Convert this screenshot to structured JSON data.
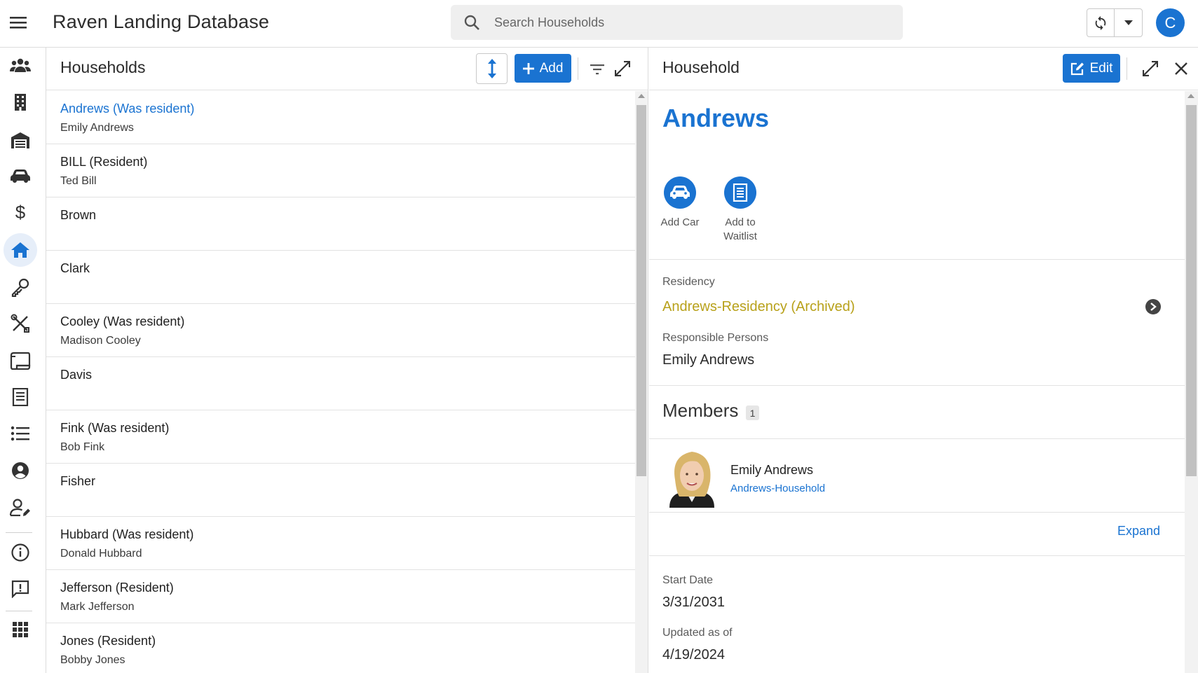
{
  "app": {
    "title": "Raven Landing Database",
    "user_initial": "C"
  },
  "search": {
    "placeholder": "Search Households"
  },
  "colors": {
    "accent": "#1a73d1",
    "archived_link": "#b8a11a"
  },
  "nav": [
    {
      "name": "people-icon",
      "active": false
    },
    {
      "name": "building-icon",
      "active": false
    },
    {
      "name": "garage-icon",
      "active": false
    },
    {
      "name": "car-icon",
      "active": false
    },
    {
      "name": "dollar-icon",
      "active": false
    },
    {
      "name": "home-icon",
      "active": true
    },
    {
      "name": "key-icon",
      "active": false
    },
    {
      "name": "tools-icon",
      "active": false
    },
    {
      "name": "scroll-icon",
      "active": false
    },
    {
      "name": "checklist-icon",
      "active": false
    },
    {
      "name": "list-icon",
      "active": false
    },
    {
      "name": "account-circle-icon",
      "active": false
    },
    {
      "name": "user-edit-icon",
      "active": false
    },
    {
      "name": "info-icon",
      "active": false
    },
    {
      "name": "feedback-icon",
      "active": false
    },
    {
      "name": "apps-grid-icon",
      "active": false
    }
  ],
  "list": {
    "title": "Households",
    "add_label": "Add",
    "items": [
      {
        "title": "Andrews (Was resident)",
        "subtitle": "Emily Andrews",
        "selected": true
      },
      {
        "title": "BILL (Resident)",
        "subtitle": "Ted Bill"
      },
      {
        "title": "Brown",
        "subtitle": ""
      },
      {
        "title": "Clark",
        "subtitle": ""
      },
      {
        "title": "Cooley (Was resident)",
        "subtitle": "Madison Cooley"
      },
      {
        "title": "Davis",
        "subtitle": ""
      },
      {
        "title": "Fink (Was resident)",
        "subtitle": "Bob Fink"
      },
      {
        "title": "Fisher",
        "subtitle": ""
      },
      {
        "title": "Hubbard (Was resident)",
        "subtitle": "Donald Hubbard"
      },
      {
        "title": "Jefferson (Resident)",
        "subtitle": "Mark Jefferson"
      },
      {
        "title": "Jones (Resident)",
        "subtitle": "Bobby Jones"
      }
    ]
  },
  "detail": {
    "title": "Household",
    "edit_label": "Edit",
    "name": "Andrews",
    "actions": [
      {
        "label": "Add Car",
        "icon": "car-icon"
      },
      {
        "label": "Add to Waitlist",
        "icon": "list-form-icon"
      }
    ],
    "residency_label": "Residency",
    "residency_value": "Andrews-Residency (Archived)",
    "responsible_label": "Responsible Persons",
    "responsible_value": "Emily Andrews",
    "members_title": "Members",
    "members_count": "1",
    "members": [
      {
        "name": "Emily Andrews",
        "household": "Andrews-Household"
      }
    ],
    "expand_label": "Expand",
    "start_date_label": "Start Date",
    "start_date_value": "3/31/2031",
    "updated_label": "Updated as of",
    "updated_value": "4/19/2024"
  }
}
